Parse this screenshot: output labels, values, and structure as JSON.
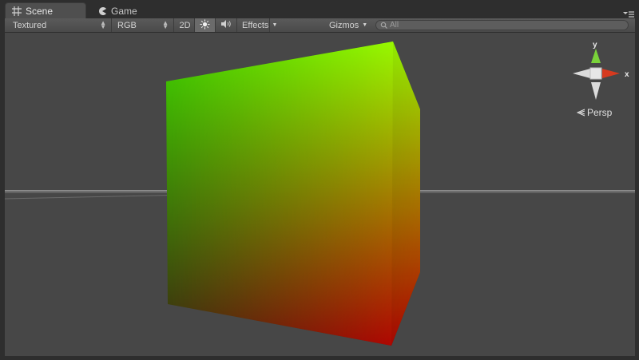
{
  "tabs": [
    {
      "label": "Scene",
      "icon": "scene-grid-icon"
    },
    {
      "label": "Game",
      "icon": "game-pacman-icon"
    }
  ],
  "toolbar": {
    "render_mode": "Textured",
    "color_mode": "RGB",
    "mode_2d": "2D",
    "lighting_icon": "sun-icon",
    "audio_icon": "speaker-icon",
    "effects": "Effects",
    "gizmos": "Gizmos",
    "search_placeholder": "All"
  },
  "gizmo": {
    "y_label": "y",
    "x_label": "x",
    "projection": "Persp",
    "colors": {
      "y": "#7ad33a",
      "x": "#d63a1f",
      "center": "#e6e6e6"
    }
  },
  "scene": {
    "object": "cube",
    "colors": {
      "top_left": "#3fd400",
      "top_right": "#a8ff00",
      "bottom_left": "#3a2a10",
      "bottom_right": "#c40000"
    }
  }
}
